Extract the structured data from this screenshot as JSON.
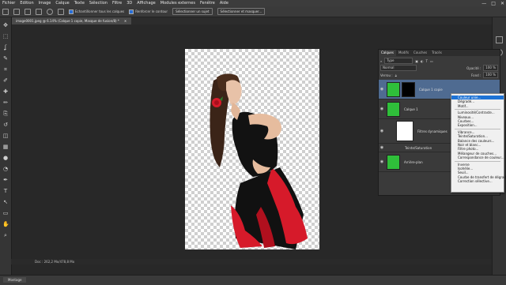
{
  "menubar": [
    "Fichier",
    "Edition",
    "Image",
    "Calque",
    "Texte",
    "Sélection",
    "Filtre",
    "3D",
    "Affichage",
    "Modules externes",
    "Fenêtre",
    "Aide"
  ],
  "window_controls": {
    "minimize": "—",
    "maximize": "□",
    "close": "✕"
  },
  "options_bar": {
    "sample_all_layers": "Echantillonner tous les calques",
    "enhance_edge": "Renforcer le contour",
    "select_subject": "Sélectionner un sujet",
    "select_and_mask": "Sélectionner et masquer..."
  },
  "document_tab": "image0001.jpeg @ 6.14% (Calque 1 copie, Masque de fusion/8) *",
  "tools": [
    "move-icon",
    "marquee-icon",
    "lasso-icon",
    "quick-select-icon",
    "crop-icon",
    "eyedropper-icon",
    "healing-icon",
    "brush-icon",
    "stamp-icon",
    "history-brush-icon",
    "eraser-icon",
    "gradient-icon",
    "blur-icon",
    "dodge-icon",
    "pen-icon",
    "type-icon",
    "path-select-icon",
    "shape-icon",
    "hand-icon",
    "zoom-icon"
  ],
  "layers_panel": {
    "tabs": [
      "Calques",
      "Modifs",
      "Couches",
      "Tracés"
    ],
    "filter_kind": "Type",
    "blend_mode": "Normal",
    "opacity_label": "Opacité :",
    "opacity_value": "100 %",
    "lock_label": "Verrou :",
    "fill_label": "Fond :",
    "fill_value": "100 %",
    "layers": [
      {
        "name": "Calque 1 copie",
        "active": true
      },
      {
        "name": "Calque 1",
        "active": false
      },
      {
        "name": "Filtres dynamiques",
        "active": false
      },
      {
        "name": "Teinte/Saturation",
        "active": false
      },
      {
        "name": "Arrière-plan",
        "active": false
      }
    ]
  },
  "context_menu": {
    "groups": [
      [
        "Couleur unie...",
        "Dégradé...",
        "Motif..."
      ],
      [
        "Luminosité/Contraste...",
        "Niveaux...",
        "Courbes...",
        "Exposition..."
      ],
      [
        "Vibrance...",
        "Teinte/Saturation...",
        "Balance des couleurs...",
        "Noir et blanc...",
        "Filtre photo...",
        "Mélangeur de couches...",
        "Correspondance de couleur..."
      ],
      [
        "Inverse",
        "Isohélie...",
        "Seuil...",
        "Courbe de transfert de dégradé...",
        "Correction sélective..."
      ]
    ],
    "highlighted": "Couleur unie..."
  },
  "status_bar": "Doc : 262,2 Mo/478,8 Mo",
  "bottom_panel_label": "Montage",
  "colors": {
    "accent": "#1e73d6",
    "green": "#2fbf3a",
    "dress_red": "#d61a2a",
    "dress_black": "#111111"
  }
}
